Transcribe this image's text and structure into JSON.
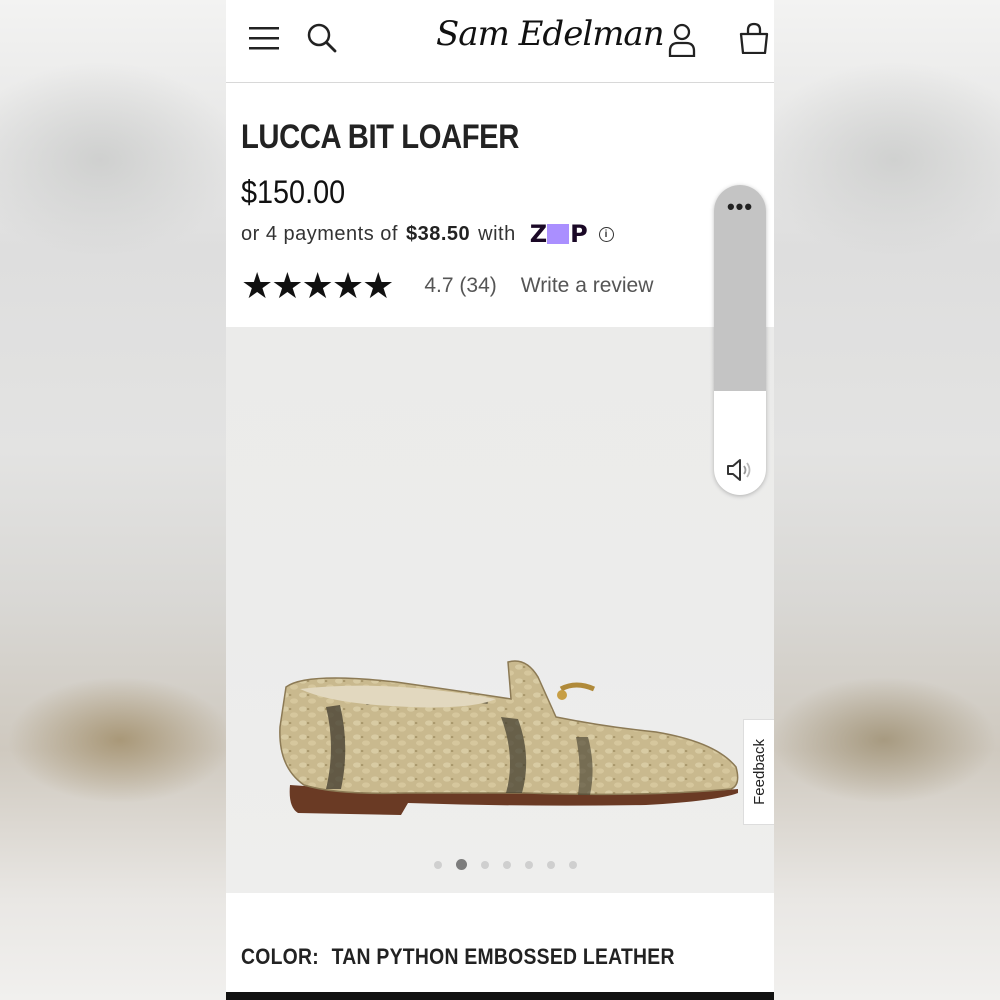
{
  "header": {
    "brand": "Sam Edelman",
    "icons": [
      "menu-icon",
      "search-icon",
      "account-icon",
      "bag-icon"
    ]
  },
  "product": {
    "title": "LUCCA BIT LOAFER",
    "price": "$150.00",
    "installments_prefix": "or 4 payments of",
    "installments_amount": "$38.50",
    "installments_with": "with",
    "zip_letters": [
      "Z",
      "P"
    ],
    "info": "i",
    "stars": "★★★★★",
    "rating_value": 4.7,
    "rating_text": "4.7 (34)",
    "review_link": "Write a review"
  },
  "gallery": {
    "total_images": 7,
    "active_index": 1,
    "feedback_label": "Feedback"
  },
  "floating_controls": {
    "more_label": "•••"
  },
  "color": {
    "label": "COLOR:",
    "value": "TAN PYTHON EMBOSSED LEATHER"
  }
}
